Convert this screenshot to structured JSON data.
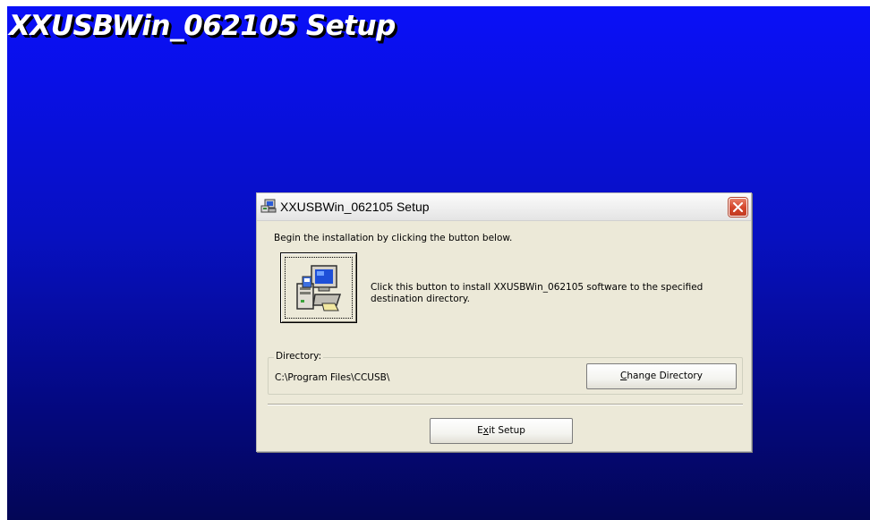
{
  "backdrop": {
    "title": "XXUSBWin_062105 Setup",
    "gradient_top": "#0a10f8",
    "gradient_bottom": "#030656"
  },
  "dialog": {
    "title": "XXUSBWin_062105 Setup",
    "app_icon": "setup-computer-icon",
    "close_icon": "close-icon",
    "close_color": "#d5482e",
    "instruction": "Begin the installation by clicking the button below.",
    "install_button_icon": "computer-install-icon",
    "install_description": "Click this button to install XXUSBWin_062105 software to the specified destination directory.",
    "directory": {
      "label": "Directory:",
      "path": "C:\\Program Files\\CCUSB\\"
    },
    "change_directory": {
      "mnemonic": "C",
      "rest": "hange Directory"
    },
    "exit_setup": {
      "prefix": "E",
      "mnemonic": "x",
      "rest": "it Setup"
    }
  }
}
